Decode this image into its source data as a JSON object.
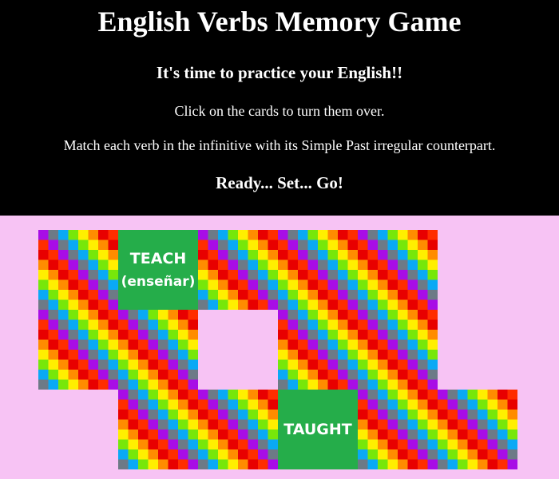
{
  "header": {
    "title": "English Verbs Memory Game",
    "subtitle": "It's time to practice your English!!",
    "instruction_1": "Click on the cards to turn them over.",
    "instruction_2": "Match each verb in the infinitive with its Simple Past irregular counterpart.",
    "ready": "Ready... Set... Go!"
  },
  "colors": {
    "header_bg": "#000000",
    "board_bg": "#f7c3f4",
    "card_face_bg": "#25ad4a",
    "card_back_pattern": [
      "#a80de6",
      "#6d7a86",
      "#0aa9f5",
      "#77e70a",
      "#ffef00",
      "#ff8c00",
      "#e80000",
      "#ff2d00"
    ]
  },
  "cards": [
    {
      "state": "back",
      "icon": "rainbow-checker-pattern"
    },
    {
      "state": "face",
      "word": "TEACH",
      "translation": "(enseñar)"
    },
    {
      "state": "back",
      "icon": "rainbow-checker-pattern"
    },
    {
      "state": "back",
      "icon": "rainbow-checker-pattern"
    },
    {
      "state": "back",
      "icon": "rainbow-checker-pattern"
    },
    {
      "state": "back",
      "icon": "rainbow-checker-pattern"
    },
    {
      "state": "matched"
    },
    {
      "state": "back",
      "icon": "rainbow-checker-pattern"
    },
    {
      "state": "back",
      "icon": "rainbow-checker-pattern"
    },
    {
      "state": "back",
      "icon": "rainbow-checker-pattern"
    },
    {
      "state": "face",
      "word": "TAUGHT",
      "translation": ""
    },
    {
      "state": "back",
      "icon": "rainbow-checker-pattern"
    },
    {
      "state": "back",
      "icon": "rainbow-checker-pattern"
    }
  ]
}
